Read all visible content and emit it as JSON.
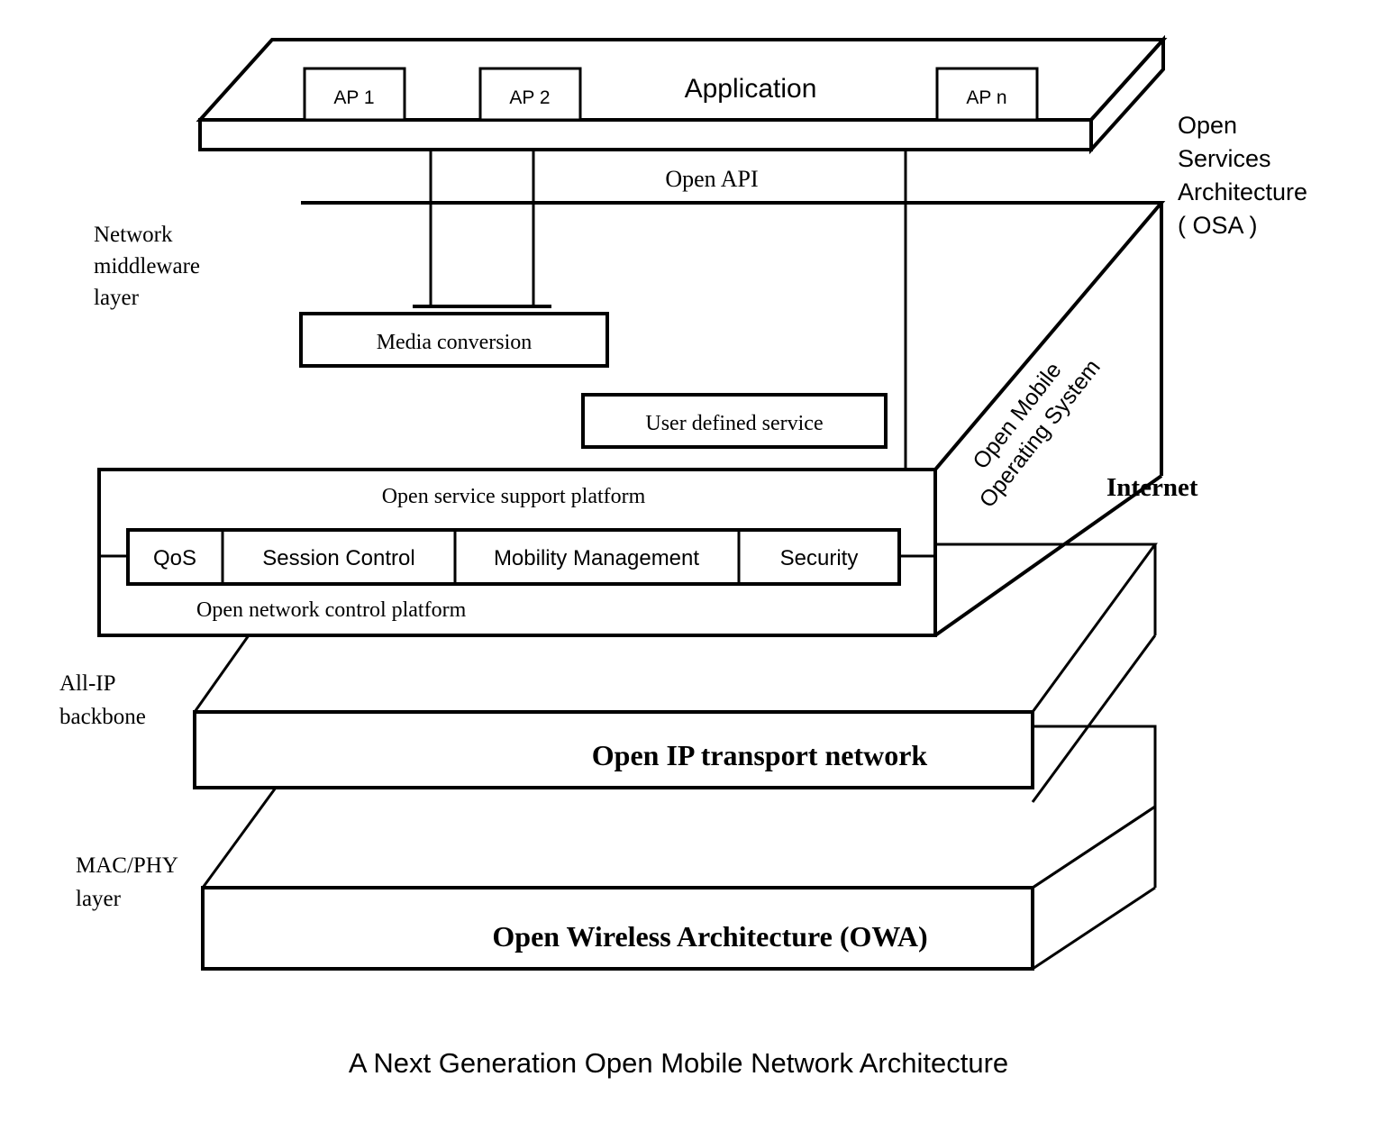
{
  "figure": {
    "caption": "A Next Generation Open Mobile Network Architecture"
  },
  "layers": {
    "application": {
      "title": "Application",
      "api_label": "Open API",
      "access_points": [
        {
          "label": "AP 1"
        },
        {
          "label": "AP 2"
        },
        {
          "label": "AP n"
        }
      ]
    },
    "middleware": {
      "side_label_lines": [
        "Network",
        "middleware",
        "layer"
      ],
      "services": [
        {
          "label": "Media conversion"
        },
        {
          "label": "User defined service"
        }
      ],
      "support_platform_label": "Open service support platform",
      "control_platform_label": "Open network control platform",
      "control_functions": [
        {
          "label": "QoS"
        },
        {
          "label": "Session Control"
        },
        {
          "label": "Mobility Management"
        },
        {
          "label": "Security"
        }
      ]
    },
    "transport": {
      "side_label_lines": [
        "All-IP",
        "backbone"
      ],
      "title": "Open IP transport network"
    },
    "physical": {
      "side_label_lines": [
        "MAC/PHY",
        "layer"
      ],
      "title": "Open Wireless Architecture (OWA)"
    }
  },
  "annotations": {
    "osa_lines": [
      "Open",
      "Services",
      "Architecture",
      "( OSA )"
    ],
    "open_mobile_os": "Open Mobile\nOperating System",
    "open_mobile_os_line1": "Open Mobile",
    "open_mobile_os_line2": "Operating System",
    "internet": "Internet"
  },
  "colors": {
    "stroke": "#000000",
    "background": "#ffffff",
    "text": "#000000"
  }
}
